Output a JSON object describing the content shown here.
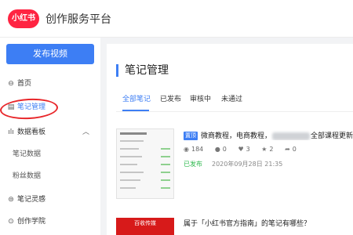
{
  "header": {
    "logo_text": "小红书",
    "title": "创作服务平台"
  },
  "sidebar": {
    "publish_button": "发布视频",
    "items": [
      {
        "icon": "home-icon",
        "label": "首页"
      },
      {
        "icon": "note-icon",
        "label": "笔记管理"
      },
      {
        "icon": "chart-icon",
        "label": "数据看板"
      },
      {
        "label": "笔记数据"
      },
      {
        "label": "粉丝数据"
      },
      {
        "icon": "inspiration-icon",
        "label": "笔记灵感"
      },
      {
        "icon": "academy-icon",
        "label": "创作学院"
      }
    ]
  },
  "main": {
    "title": "笔记管理",
    "tabs": [
      "全部笔记",
      "已发布",
      "审核中",
      "未通过"
    ],
    "notes": [
      {
        "badge": "置顶",
        "title_before": "微商教程，电商教程，",
        "title_after": "全部课程更新",
        "stats": {
          "views": "184",
          "comments": "0",
          "likes": "3",
          "collects": "2",
          "shares": "0"
        },
        "status": "已发布",
        "time": "2020年09月28日 21:35"
      },
      {
        "thumb_text": "百收传媒",
        "title": "属于「小红书官方指南」的笔记有哪些？"
      }
    ]
  },
  "colors": {
    "accent": "#3d7ef4",
    "brand": "#ff2442",
    "annotation": "#e8262a",
    "published": "#2db84d"
  }
}
